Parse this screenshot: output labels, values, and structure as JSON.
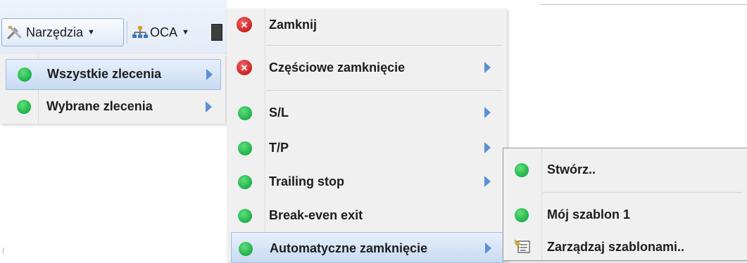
{
  "toolbar": {
    "narzedzia_label": "Narzędzia",
    "oca_label": "OCA"
  },
  "menu1": {
    "items": [
      {
        "label": "Wszystkie zlecenia",
        "icon": "green-dot-icon",
        "submenu": true
      },
      {
        "label": "Wybrane zlecenia",
        "icon": "green-dot-icon",
        "submenu": true
      }
    ]
  },
  "menu2": {
    "items": [
      {
        "label": "Zamknij",
        "icon": "red-close-icon"
      },
      {
        "label": "Częściowe zamknięcie",
        "icon": "red-close-icon",
        "submenu": true
      },
      {
        "label": "S/L",
        "icon": "green-dot-icon",
        "submenu": true
      },
      {
        "label": "T/P",
        "icon": "green-dot-icon",
        "submenu": true
      },
      {
        "label": "Trailing stop",
        "icon": "green-dot-icon",
        "submenu": true
      },
      {
        "label": "Break-even exit",
        "icon": "green-dot-icon"
      },
      {
        "label": "Automatyczne zamknięcie",
        "icon": "green-dot-icon",
        "submenu": true
      }
    ]
  },
  "menu3": {
    "items": [
      {
        "label": "Stwórz..",
        "icon": "green-dot-icon"
      },
      {
        "label": "Mój szablon 1",
        "icon": "green-dot-icon"
      },
      {
        "label": "Zarządzaj szablonami..",
        "icon": "template-manage-icon"
      }
    ]
  },
  "colors": {
    "highlight": "#c8daf2",
    "menu_bg": "#f0f0f0",
    "green": "#1fb04b",
    "red": "#c81c1c",
    "arrow": "#5b8fd6"
  }
}
